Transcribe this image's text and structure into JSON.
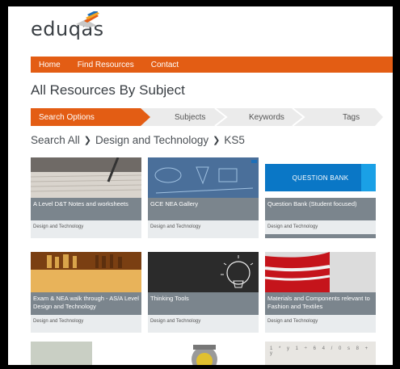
{
  "brand": {
    "logo_text": "eduqas",
    "accent": "#e35d14"
  },
  "nav": {
    "items": [
      "Home",
      "Find Resources",
      "Contact"
    ]
  },
  "page": {
    "title": "All Resources By Subject"
  },
  "tabs": {
    "active": "Search Options",
    "subjects": "Subjects",
    "keywords": "Keywords",
    "tags": "Tags"
  },
  "breadcrumb": {
    "root": "Search All",
    "subject": "Design and Technology",
    "stage": "KS5"
  },
  "cards": [
    {
      "title": "A Level D&T Notes and worksheets",
      "category": "Design and Technology"
    },
    {
      "title": "GCE NEA Gallery",
      "category": "Design and Technology"
    },
    {
      "title": "Question Bank (Student focused)",
      "category": "Design and Technology",
      "banner": "QUESTION BANK"
    },
    {
      "title": "Exam & NEA walk through - AS/A Level Design and Technology",
      "category": "Design and Technology"
    },
    {
      "title": "Thinking Tools",
      "category": "Design and Technology"
    },
    {
      "title": "Materials and Components relevant to Fashion and Textiles",
      "category": "Design and Technology"
    }
  ]
}
